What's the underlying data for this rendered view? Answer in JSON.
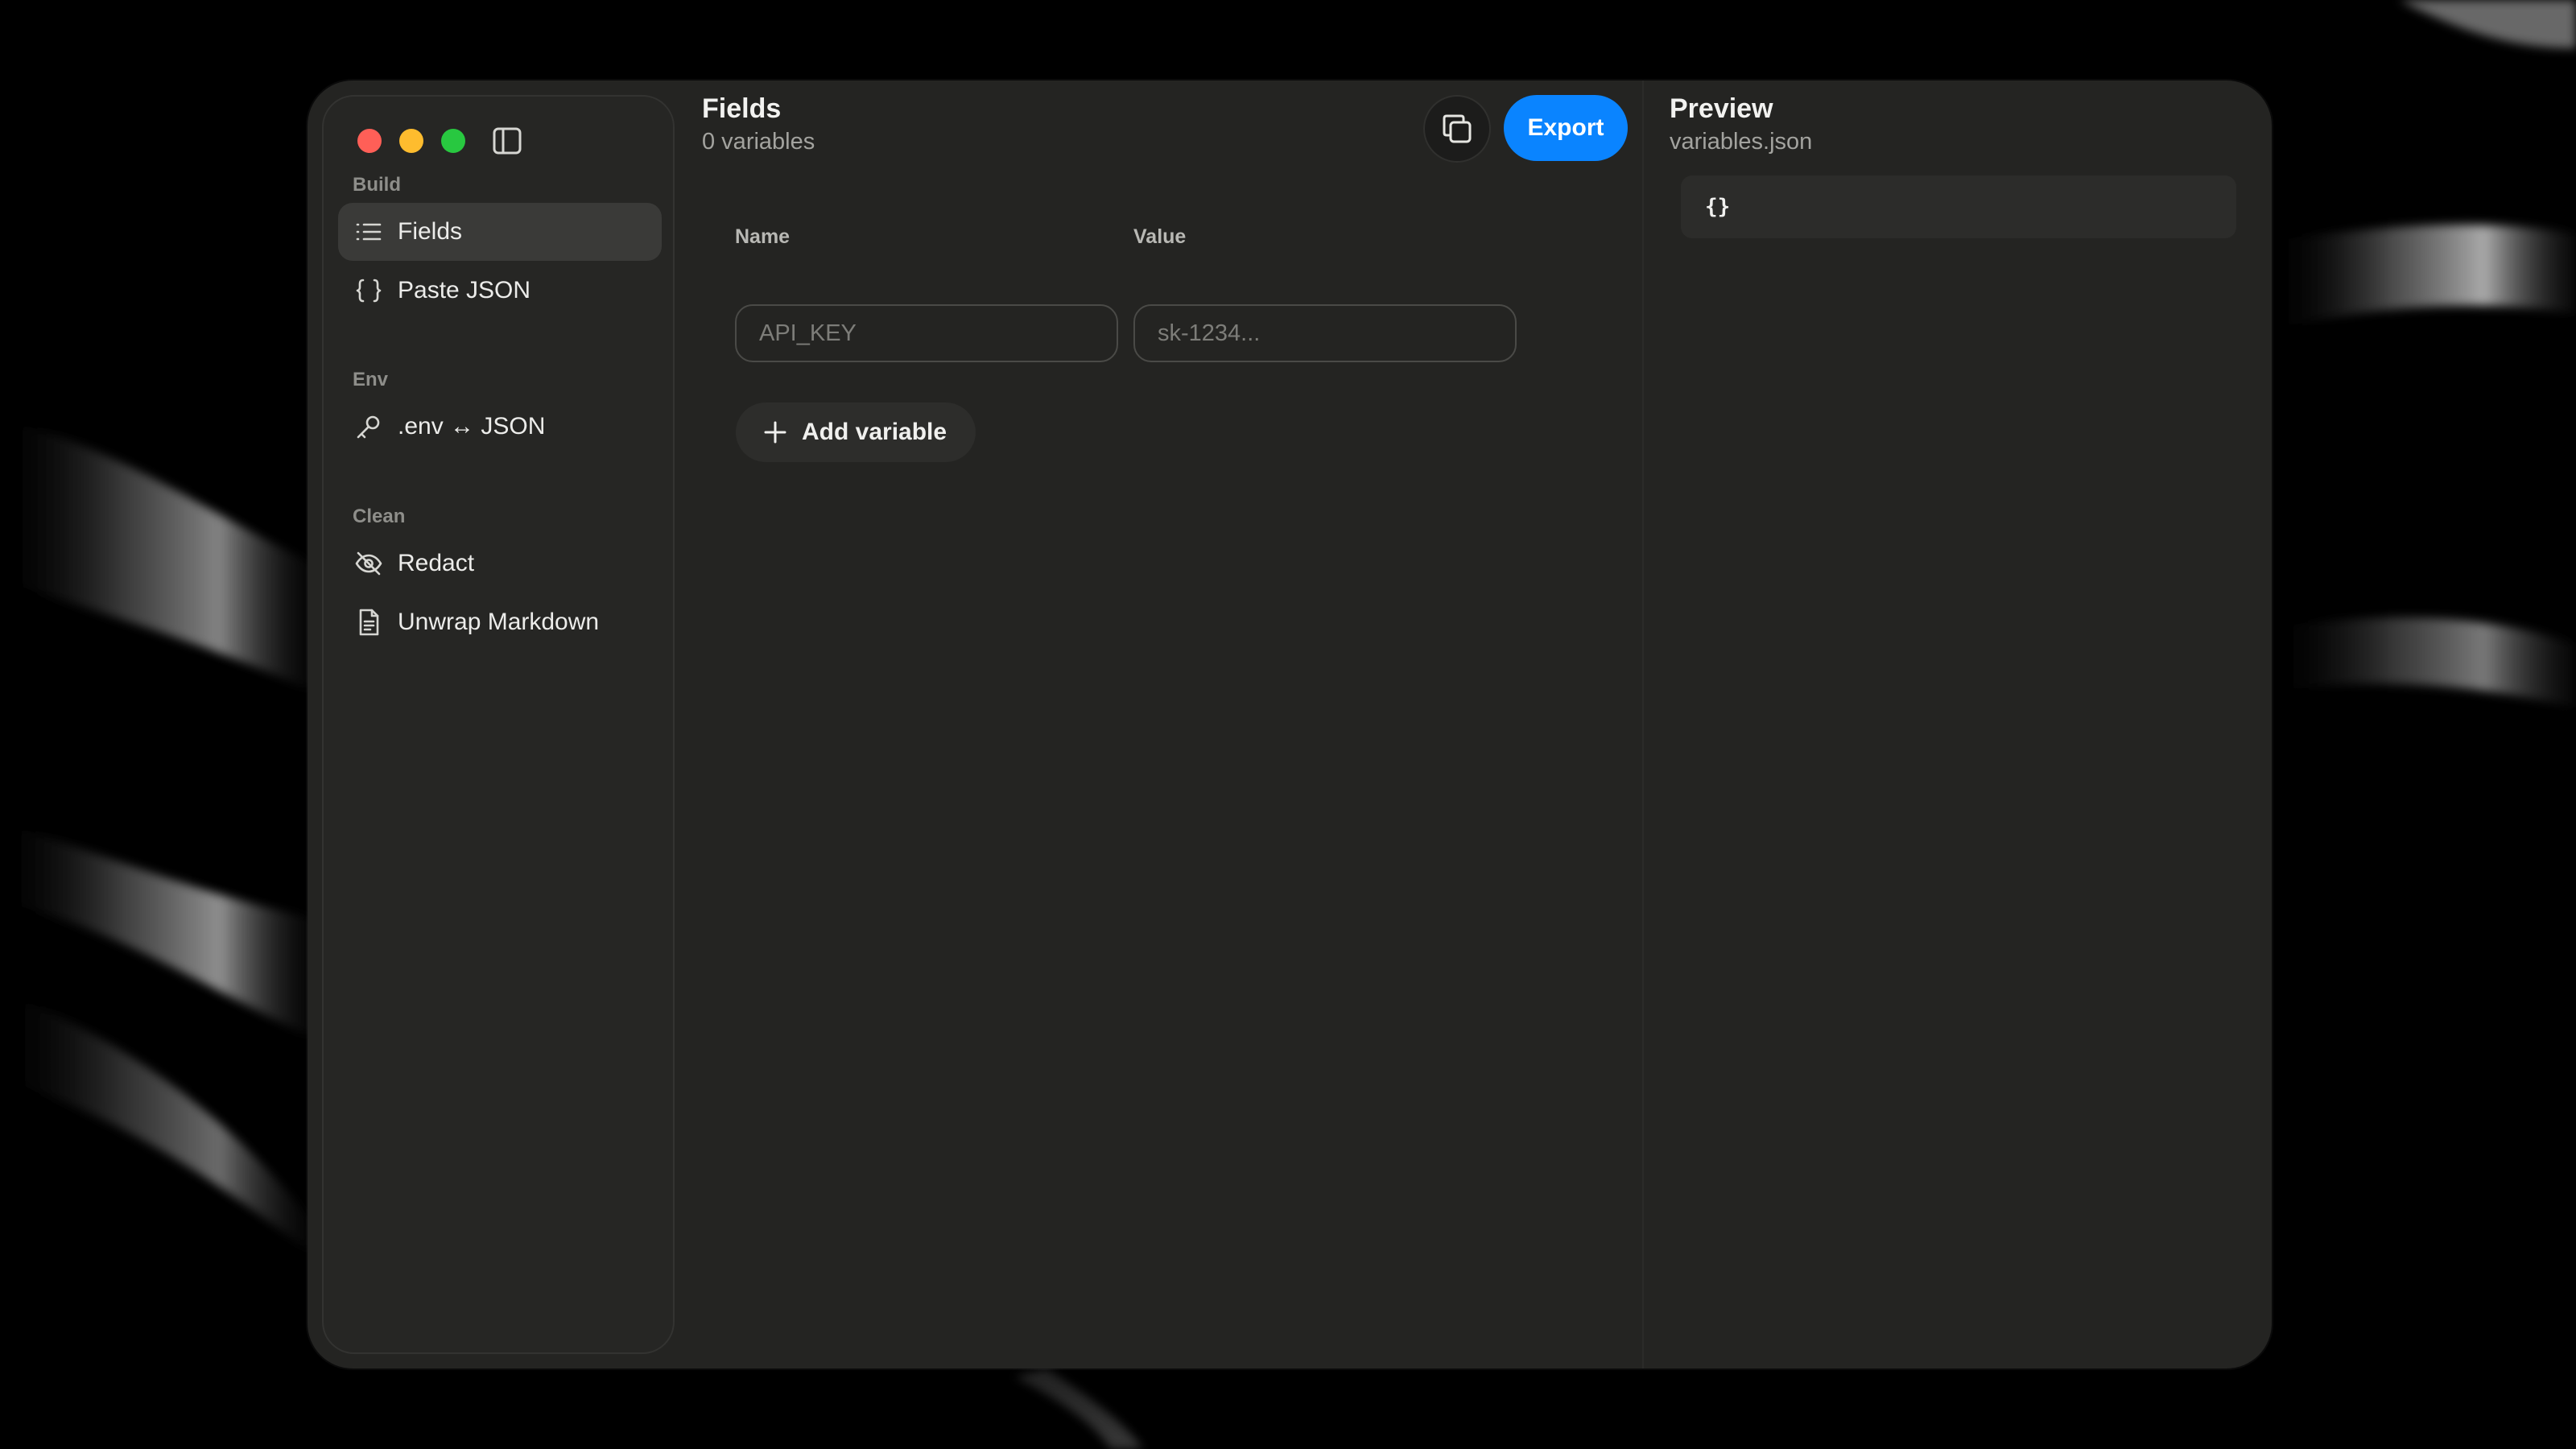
{
  "window": {
    "traffic_lights": [
      "close",
      "minimize",
      "zoom"
    ]
  },
  "sidebar": {
    "toggle_icon": "sidebar-icon",
    "sections": [
      {
        "label": "Build",
        "items": [
          {
            "label": "Fields",
            "icon": "list-icon",
            "active": true
          },
          {
            "label": "Paste JSON",
            "icon": "braces-icon",
            "active": false
          }
        ]
      },
      {
        "label": "Env",
        "items": [
          {
            "label": ".env ↔ JSON",
            "icon": "key-icon",
            "active": false
          }
        ]
      },
      {
        "label": "Clean",
        "items": [
          {
            "label": "Redact",
            "icon": "eye-off-icon",
            "active": false
          },
          {
            "label": "Unwrap Markdown",
            "icon": "document-icon",
            "active": false
          }
        ]
      }
    ]
  },
  "main": {
    "title": "Fields",
    "subtitle": "0 variables",
    "copy_icon": "copy-icon",
    "export_label": "Export",
    "columns": {
      "name": "Name",
      "value": "Value"
    },
    "row": {
      "name_placeholder": "API_KEY",
      "value_placeholder": "sk-1234...",
      "name_value": "",
      "value_value": ""
    },
    "add_label": "Add variable"
  },
  "preview": {
    "title": "Preview",
    "filename": "variables.json",
    "code": "{}"
  },
  "colors": {
    "accent": "#0a84ff",
    "close": "#ff5f57",
    "minimize": "#febc2e",
    "zoom": "#28c840",
    "window_bg": "#242422"
  }
}
